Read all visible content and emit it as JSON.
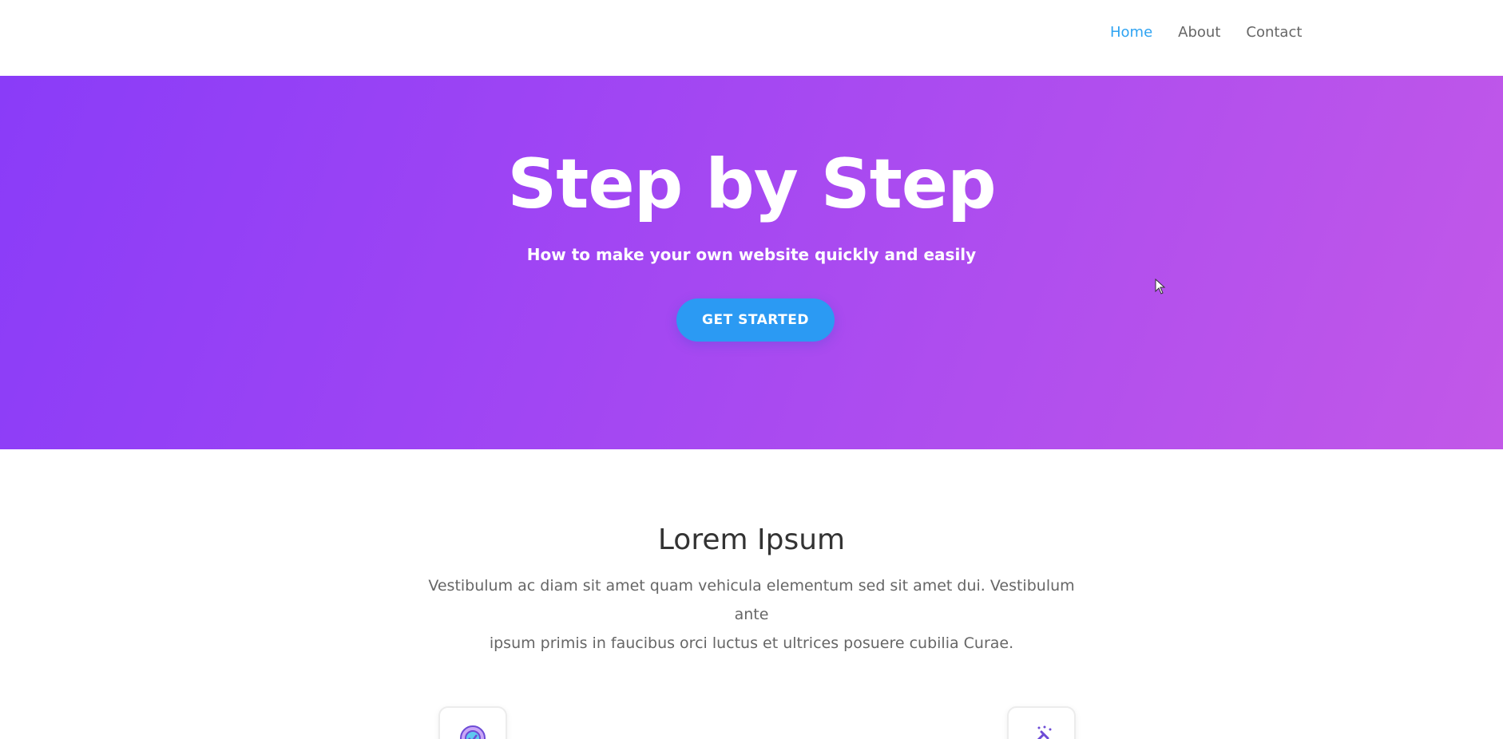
{
  "nav": {
    "items": [
      {
        "label": "Home",
        "active": true
      },
      {
        "label": "About",
        "active": false
      },
      {
        "label": "Contact",
        "active": false
      }
    ]
  },
  "hero": {
    "title": "Step by Step",
    "subtitle": "How to make your own website quickly and easily",
    "cta_label": "GET STARTED"
  },
  "section": {
    "title": "Lorem Ipsum",
    "body_line1": "Vestibulum ac diam sit amet quam vehicula elementum sed sit amet dui. Vestibulum ante",
    "body_line2": "ipsum primis in faucibus orci luctus et ultrices posuere cubilia Curae."
  },
  "features": [
    {
      "icon": "target-check-icon"
    },
    {
      "icon": "tools-icon"
    }
  ],
  "colors": {
    "accent": "#2ea3f2",
    "cta": "#2b9af3",
    "gradient_start": "#8a3cf8",
    "gradient_end": "#c258e8"
  }
}
